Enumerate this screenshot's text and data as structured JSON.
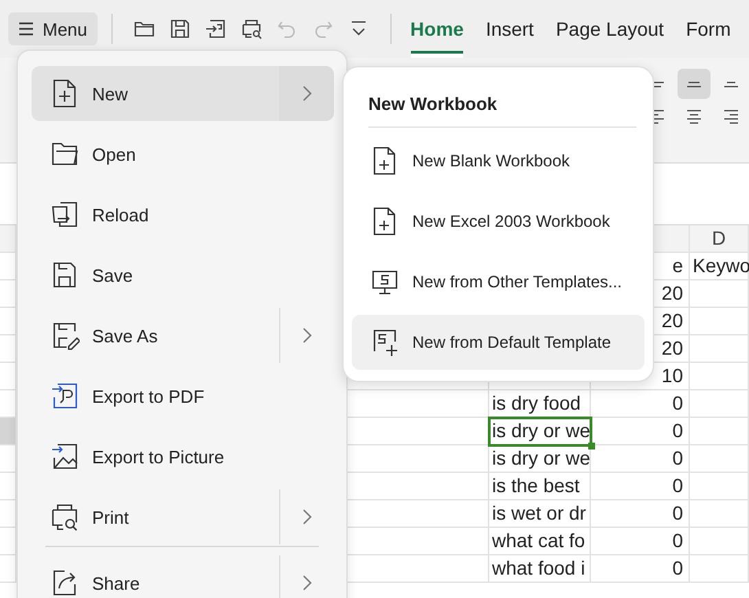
{
  "toolbar": {
    "menu_button": "Menu",
    "quick_actions": [
      {
        "kind": "open",
        "disabled": false
      },
      {
        "kind": "save",
        "disabled": false
      },
      {
        "kind": "export",
        "disabled": false
      },
      {
        "kind": "print-preview",
        "disabled": false
      },
      {
        "kind": "undo",
        "disabled": true
      },
      {
        "kind": "redo",
        "disabled": true
      },
      {
        "kind": "customize",
        "disabled": false
      }
    ],
    "tabs": [
      {
        "label": "Home",
        "selected": true
      },
      {
        "label": "Insert",
        "selected": false
      },
      {
        "label": "Page Layout",
        "selected": false
      },
      {
        "label": "Form",
        "selected": false
      }
    ]
  },
  "ribbon": {
    "align_buttons": [
      {
        "kind": "top",
        "selected": false
      },
      {
        "kind": "middle",
        "selected": true
      },
      {
        "kind": "bottom",
        "selected": false
      },
      {
        "kind": "left",
        "selected": false
      },
      {
        "kind": "center",
        "selected": false
      },
      {
        "kind": "right",
        "selected": false
      }
    ]
  },
  "sheet": {
    "column_header": "D",
    "rows": [
      {
        "b": "",
        "c": "e",
        "d": "Keywo",
        "selected": false
      },
      {
        "b": "",
        "c": "20",
        "d": "",
        "selected": false
      },
      {
        "b": "",
        "c": "20",
        "d": "",
        "selected": false
      },
      {
        "b": "",
        "c": "20",
        "d": "",
        "selected": false
      },
      {
        "b": "",
        "c": "10",
        "d": "",
        "selected": false
      },
      {
        "b": "is dry food",
        "c": "0",
        "d": "",
        "selected": false
      },
      {
        "b": "is dry or we",
        "c": "0",
        "d": "",
        "selected": true
      },
      {
        "b": "is dry or we",
        "c": "0",
        "d": "",
        "selected": false
      },
      {
        "b": "is the best",
        "c": "0",
        "d": "",
        "selected": false
      },
      {
        "b": "is wet or dr",
        "c": "0",
        "d": "",
        "selected": false
      },
      {
        "b": "what cat fo",
        "c": "0",
        "d": "",
        "selected": false
      },
      {
        "b": "what food i",
        "c": "0",
        "d": "",
        "selected": false
      }
    ]
  },
  "menu": {
    "groups": [
      {
        "items": [
          {
            "label": "New",
            "kind": "new",
            "submenu": true,
            "selected": true
          },
          {
            "label": "Open",
            "kind": "open",
            "submenu": false,
            "selected": false
          },
          {
            "label": "Reload",
            "kind": "reload",
            "submenu": false,
            "selected": false
          },
          {
            "label": "Save",
            "kind": "save",
            "submenu": false,
            "selected": false
          },
          {
            "label": "Save As",
            "kind": "saveas",
            "submenu": true,
            "selected": false
          },
          {
            "label": "Export to PDF",
            "kind": "pdf",
            "submenu": false,
            "selected": false
          },
          {
            "label": "Export to Picture",
            "kind": "picture",
            "submenu": false,
            "selected": false
          },
          {
            "label": "Print",
            "kind": "print",
            "submenu": true,
            "selected": false
          }
        ]
      },
      {
        "items": [
          {
            "label": "Share",
            "kind": "share",
            "submenu": true,
            "selected": false
          }
        ]
      }
    ]
  },
  "submenu": {
    "title": "New Workbook",
    "items": [
      {
        "label": "New Blank Workbook",
        "kind": "blank",
        "selected": false
      },
      {
        "label": "New Excel 2003 Workbook",
        "kind": "blank",
        "selected": false
      },
      {
        "label": "New from Other Templates...",
        "kind": "templates",
        "selected": false
      },
      {
        "label": "New from Default Template",
        "kind": "default",
        "selected": true
      }
    ]
  }
}
